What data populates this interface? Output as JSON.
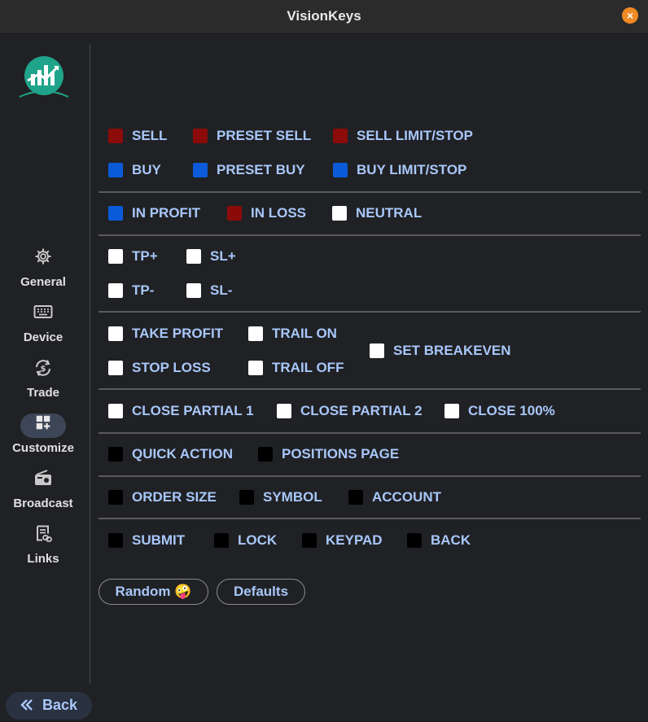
{
  "window": {
    "title": "VisionKeys",
    "close_glyph": "×"
  },
  "sidebar": {
    "logo": "vision-keys-logo",
    "items": [
      {
        "label": "General",
        "icon": "gear-icon",
        "active": false
      },
      {
        "label": "Device",
        "icon": "keyboard-icon",
        "active": false
      },
      {
        "label": "Trade",
        "icon": "currency-exchange-icon",
        "active": false
      },
      {
        "label": "Customize",
        "icon": "dashboard-add-icon",
        "active": true
      },
      {
        "label": "Broadcast",
        "icon": "radio-icon",
        "active": false
      },
      {
        "label": "Links",
        "icon": "link-doc-icon",
        "active": false
      }
    ],
    "back_label": "Back"
  },
  "colors": {
    "sell": "#8b0b0b",
    "buy": "#0b5ad9",
    "white": "#ffffff",
    "black": "#000000",
    "text": "#a8c7fa"
  },
  "swatches": {
    "sell": "SELL",
    "preset_sell": "PRESET SELL",
    "sell_limit_stop": "SELL LIMIT/STOP",
    "buy": "BUY",
    "preset_buy": "PRESET BUY",
    "buy_limit_stop": "BUY LIMIT/STOP",
    "in_profit": "IN PROFIT",
    "in_loss": "IN LOSS",
    "neutral": "NEUTRAL",
    "tp_plus": "TP+",
    "sl_plus": "SL+",
    "tp_minus": "TP-",
    "sl_minus": "SL-",
    "take_profit": "TAKE PROFIT",
    "trail_on": "TRAIL ON",
    "set_breakeven": "SET BREAKEVEN",
    "stop_loss": "STOP LOSS",
    "trail_off": "TRAIL OFF",
    "close_partial_1": "CLOSE PARTIAL 1",
    "close_partial_2": "CLOSE PARTIAL 2",
    "close_100": "CLOSE 100%",
    "quick_action": "QUICK ACTION",
    "positions_page": "POSITIONS PAGE",
    "order_size": "ORDER SIZE",
    "symbol": "SYMBOL",
    "account": "ACCOUNT",
    "submit": "SUBMIT",
    "lock": "LOCK",
    "keypad": "KEYPAD",
    "back": "BACK"
  },
  "actions": {
    "random_label": "Random 🤪",
    "defaults_label": "Defaults"
  }
}
